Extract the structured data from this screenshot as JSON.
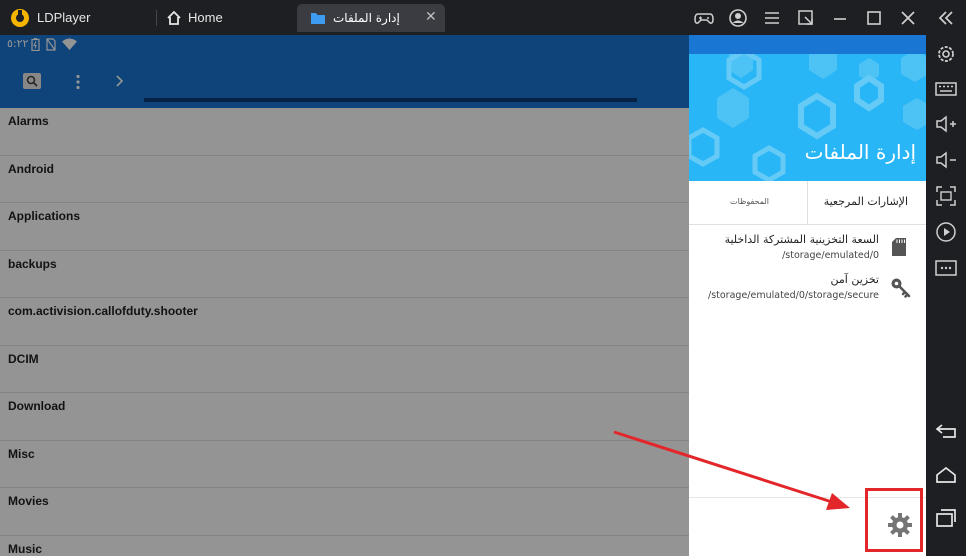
{
  "window": {
    "app_name": "LDPlayer",
    "tabs": [
      {
        "label": "Home",
        "icon": "home-icon"
      },
      {
        "label": "إدارة الملفات",
        "icon": "folder-icon",
        "close": "✕"
      }
    ]
  },
  "status_bar": {
    "time": "٥:٢٢"
  },
  "file_list": {
    "items": [
      "Alarms",
      "Android",
      "Applications",
      "backups",
      "com.activision.callofduty.shooter",
      "DCIM",
      "Download",
      "Misc",
      "Movies",
      "Music"
    ]
  },
  "drawer": {
    "title": "إدارة الملفات",
    "tabs": {
      "bookmarks": "الإشارات المرجعية",
      "saved": "المحفوظات"
    },
    "storage": [
      {
        "title": "السعة التخزينية المشتركة الداخلية",
        "path": "/storage/emulated/0",
        "icon": "sd-card-icon"
      },
      {
        "title": "تخزين آمن",
        "path": "/storage/emulated/0/storage/secure",
        "icon": "key-icon"
      }
    ]
  },
  "colors": {
    "android_blue": "#1976d2",
    "drawer_header": "#29b6f6",
    "highlight_red": "#e3262a",
    "titlebar": "#1e1f23"
  }
}
